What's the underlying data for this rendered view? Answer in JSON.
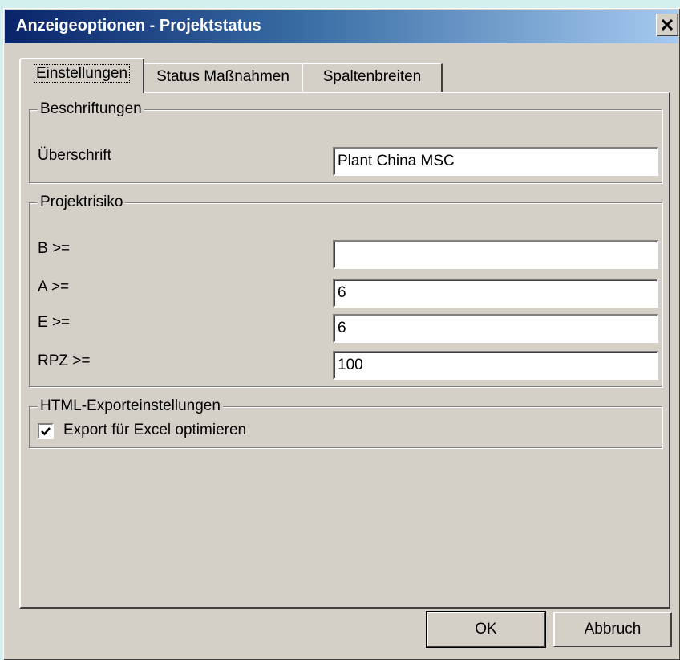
{
  "window": {
    "title": "Anzeigeoptionen - Projektstatus",
    "close_glyph": "✕"
  },
  "tabs": [
    {
      "label": "Einstellungen",
      "active": true
    },
    {
      "label": "Status Maßnahmen",
      "active": false
    },
    {
      "label": "Spaltenbreiten",
      "active": false
    }
  ],
  "beschriftungen": {
    "legend": "Beschriftungen",
    "ueberschrift_label": "Überschrift",
    "ueberschrift_value": "Plant China MSC"
  },
  "projektrisiko": {
    "legend": "Projektrisiko",
    "b_label": "B >=",
    "b_value": "",
    "a_label": "A >=",
    "a_value": "6",
    "e_label": "E >=",
    "e_value": "6",
    "rpz_label": "RPZ >=",
    "rpz_value": "100"
  },
  "html_export": {
    "legend": "HTML-Exporteinstellungen",
    "excel_label": "Export für Excel optimieren",
    "excel_checked": true
  },
  "buttons": {
    "ok": "OK",
    "cancel": "Abbruch"
  },
  "icons": {
    "close": "close-icon",
    "check": "checkmark-icon"
  },
  "colors": {
    "titlebar_start": "#0a246a",
    "titlebar_end": "#a6caf0",
    "face": "#d4d0c8"
  }
}
